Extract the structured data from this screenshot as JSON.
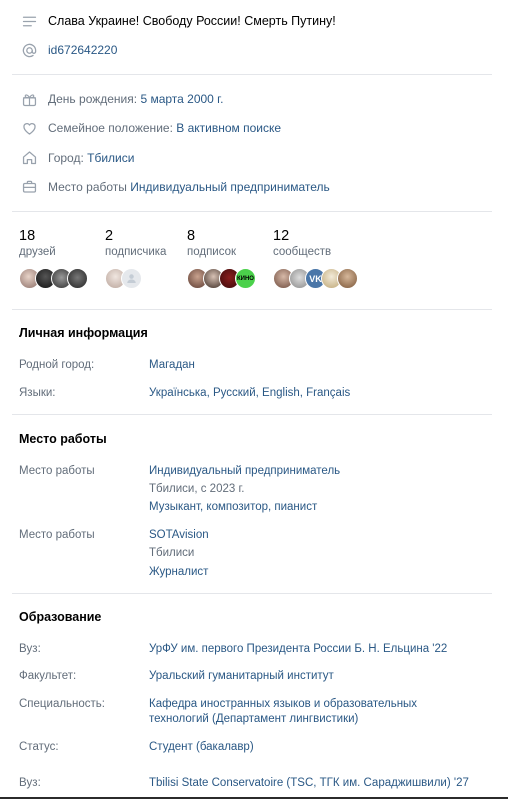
{
  "profile": {
    "status": "Слава Украине! Свободу России! Смерть Путину!",
    "screen_name": "id672642220",
    "birthday_label": "День рождения:",
    "birthday_value": "5 марта 2000 г.",
    "relationship_label": "Семейное положение:",
    "relationship_value": "В активном поиске",
    "city_label": "Город:",
    "city_value": "Тбилиси",
    "work_label": "Место работы",
    "work_value": "Индивидуальный предприниматель"
  },
  "counters": [
    {
      "num": "18",
      "label": "друзей"
    },
    {
      "num": "2",
      "label": "подписчика"
    },
    {
      "num": "8",
      "label": "подписок"
    },
    {
      "num": "12",
      "label": "сообществ"
    }
  ],
  "personal": {
    "title": "Личная информация",
    "hometown_label": "Родной город:",
    "hometown_value": "Магадан",
    "languages_label": "Языки:",
    "languages": [
      "Українська",
      "Русский",
      "English",
      "Français"
    ],
    "separator": ", "
  },
  "career": {
    "title": "Место работы",
    "items": [
      {
        "label": "Место работы",
        "company": "Индивидуальный предприниматель",
        "details": "Тбилиси, с 2023 г.",
        "position": "Музыкант, композитор, пианист"
      },
      {
        "label": "Место работы",
        "company": "SOTAvision",
        "details": "Тбилиси",
        "position": "Журналист"
      }
    ]
  },
  "education": {
    "title": "Образование",
    "university_label": "Вуз:",
    "university_value": "УрФУ им. первого Президента России Б. Н. Ельцина '22",
    "faculty_label": "Факультет:",
    "faculty_value": "Уральский гуманитарный институт",
    "speciality_label": "Специальность:",
    "speciality_line1": "Кафедра иностранных языков и образовательных",
    "speciality_line2": "технологий (Департамент лингвистики)",
    "status_label": "Статус:",
    "status_value": "Студент (бакалавр)",
    "university2_label": "Вуз:",
    "university2_value": "Tbilisi State Conservatoire (TSC, ТГК им. Сараджишвили) '27"
  },
  "badges": {
    "vk": "VK",
    "kino": "КИНО"
  },
  "colors": {
    "link": "#2a5885",
    "label": "#626d7a",
    "icon": "#99a2ad",
    "divider": "#e4e6ea"
  }
}
